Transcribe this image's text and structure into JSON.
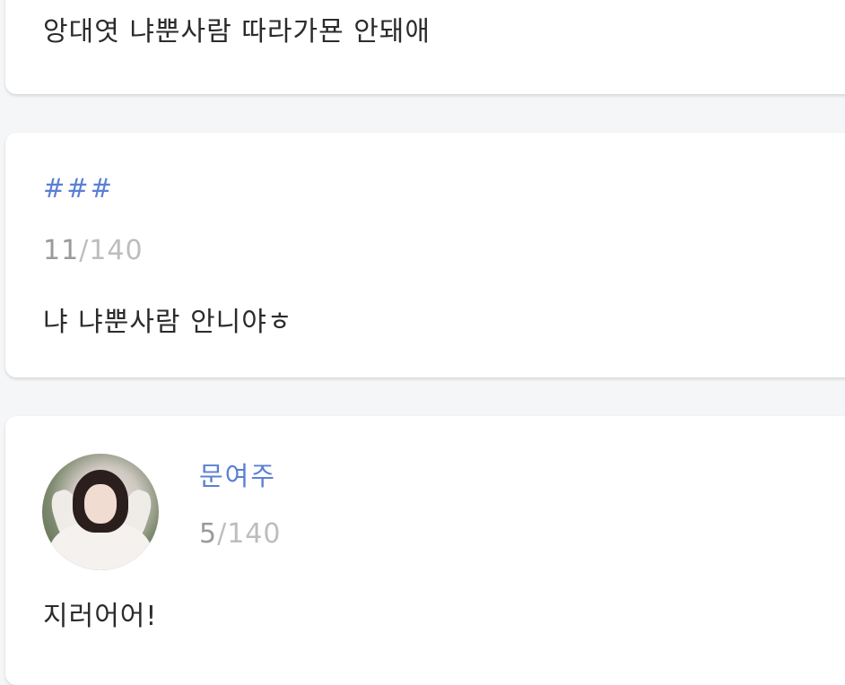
{
  "posts": [
    {
      "message": "앙대엿 냐뿐사람 따라가묜 안돼애"
    },
    {
      "name": "###",
      "count_current": "11",
      "count_max": "/140",
      "message": "냐 냐뿐사람 안니야ㅎ"
    },
    {
      "name": "문여주",
      "count_current": "5",
      "count_max": "/140",
      "message": "지러어어!"
    }
  ]
}
